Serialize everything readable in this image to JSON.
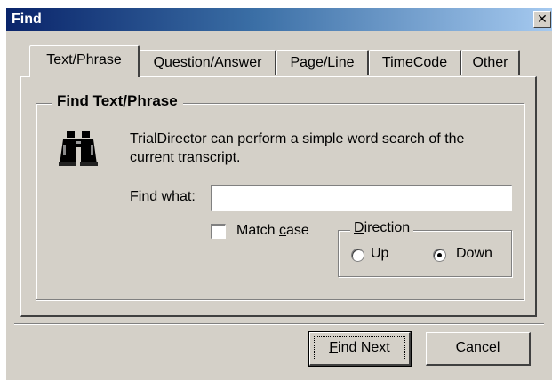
{
  "window": {
    "title": "Find",
    "close_glyph": "✕"
  },
  "tabs": [
    {
      "label": "Text/Phrase",
      "active": true
    },
    {
      "label": "Question/Answer",
      "active": false
    },
    {
      "label": "Page/Line",
      "active": false
    },
    {
      "label": "TimeCode",
      "active": false
    },
    {
      "label": "Other",
      "active": false
    }
  ],
  "group": {
    "title": "Find Text/Phrase",
    "icon": "binoculars-icon",
    "description": "TrialDirector can perform a simple word search of the current transcript."
  },
  "find": {
    "label_before": "Fi",
    "label_mnemonic": "n",
    "label_after": "d what:",
    "value": ""
  },
  "match_case": {
    "label_before": "Match ",
    "label_mnemonic": "c",
    "label_after": "ase",
    "checked": false
  },
  "direction": {
    "legend_mnemonic": "D",
    "legend_after": "irection",
    "up_label": "Up",
    "down_label": "Down",
    "selected": "Down"
  },
  "buttons": {
    "find_next_mnemonic": "F",
    "find_next_after": "ind Next",
    "cancel": "Cancel"
  },
  "colors": {
    "dialog_face": "#d4d0c8",
    "title_start": "#0a246a",
    "title_end": "#a6caf0"
  }
}
